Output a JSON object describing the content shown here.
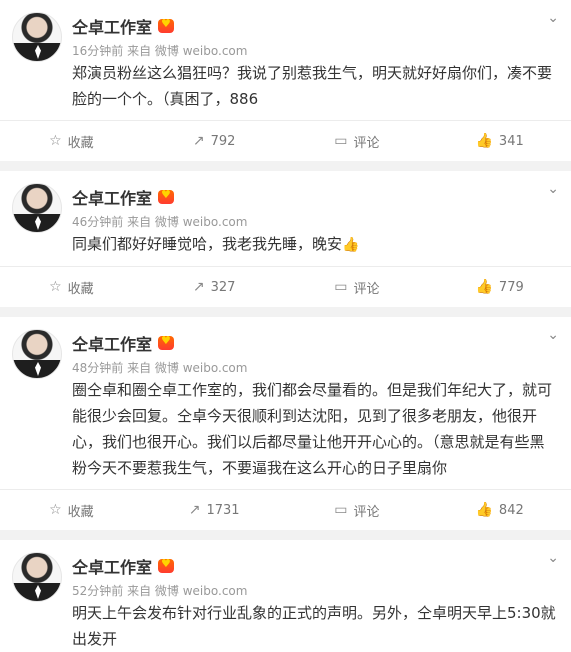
{
  "posts": [
    {
      "name": "仝卓工作室",
      "time": "16分钟前",
      "source": "来自 微博 weibo.com",
      "text": "郑演员粉丝这么猖狂吗？我说了别惹我生气，明天就好好扇你们，凑不要脸的一个个。（真困了，886",
      "collect": "收藏",
      "repost": "792",
      "comment": "评论",
      "like": "341"
    },
    {
      "name": "仝卓工作室",
      "time": "46分钟前",
      "source": "来自 微博 weibo.com",
      "text": "同桌们都好好睡觉哈，我老我先睡，晚安",
      "collect": "收藏",
      "repost": "327",
      "comment": "评论",
      "like": "779"
    },
    {
      "name": "仝卓工作室",
      "time": "48分钟前",
      "source": "来自 微博 weibo.com",
      "text": "圈仝卓和圈仝卓工作室的，我们都会尽量看的。但是我们年纪大了，就可能很少会回复。仝卓今天很顺利到达沈阳，见到了很多老朋友，他很开心，我们也很开心。我们以后都尽量让他开开心心的。（意思就是有些黑粉今天不要惹我生气，不要逼我在这么开心的日子里扇你",
      "collect": "收藏",
      "repost": "1731",
      "comment": "评论",
      "like": "842"
    },
    {
      "name": "仝卓工作室",
      "time": "52分钟前",
      "source": "来自 微博 weibo.com",
      "text": "明天上午会发布针对行业乱象的正式的声明。另外，仝卓明天早上5:30就出发开"
    }
  ]
}
